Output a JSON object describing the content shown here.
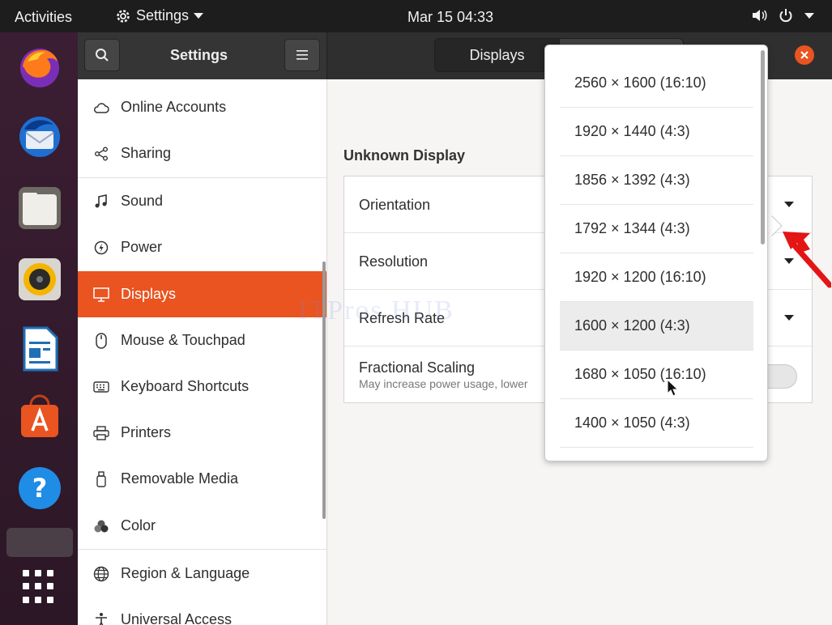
{
  "topbar": {
    "activities": "Activities",
    "app_name": "Settings",
    "clock": "Mar 15  04:33"
  },
  "headerbar": {
    "title": "Settings",
    "tab_displays": "Displays"
  },
  "sidebar": {
    "items": [
      {
        "label": "Online Accounts",
        "icon": "cloud-icon"
      },
      {
        "label": "Sharing",
        "icon": "share-icon"
      },
      {
        "label": "Sound",
        "icon": "music-note-icon"
      },
      {
        "label": "Power",
        "icon": "power-icon"
      },
      {
        "label": "Displays",
        "icon": "display-icon"
      },
      {
        "label": "Mouse & Touchpad",
        "icon": "mouse-icon"
      },
      {
        "label": "Keyboard Shortcuts",
        "icon": "keyboard-icon"
      },
      {
        "label": "Printers",
        "icon": "printer-icon"
      },
      {
        "label": "Removable Media",
        "icon": "usb-icon"
      },
      {
        "label": "Color",
        "icon": "color-icon"
      },
      {
        "label": "Region & Language",
        "icon": "globe-icon"
      },
      {
        "label": "Universal Access",
        "icon": "accessibility-icon"
      }
    ],
    "active": "Displays"
  },
  "display": {
    "section_title": "Unknown Display",
    "orientation_label": "Orientation",
    "resolution_label": "Resolution",
    "refresh_label": "Refresh Rate",
    "scaling_label": "Fractional Scaling",
    "scaling_sub": "May increase power usage, lower"
  },
  "resolution_options": [
    "2560 × 1600 (16:10)",
    "1920 × 1440 (4:3)",
    "1856 × 1392 (4:3)",
    "1792 × 1344 (4:3)",
    "1920 × 1200 (16:10)",
    "1600 × 1200 (4:3)",
    "1680 × 1050 (16:10)",
    "1400 × 1050 (4:3)"
  ],
  "watermark": "ITPros HUB",
  "colors": {
    "accent": "#e95420",
    "headerbar": "#2f2f2f",
    "topbar": "#1d1d1d"
  }
}
